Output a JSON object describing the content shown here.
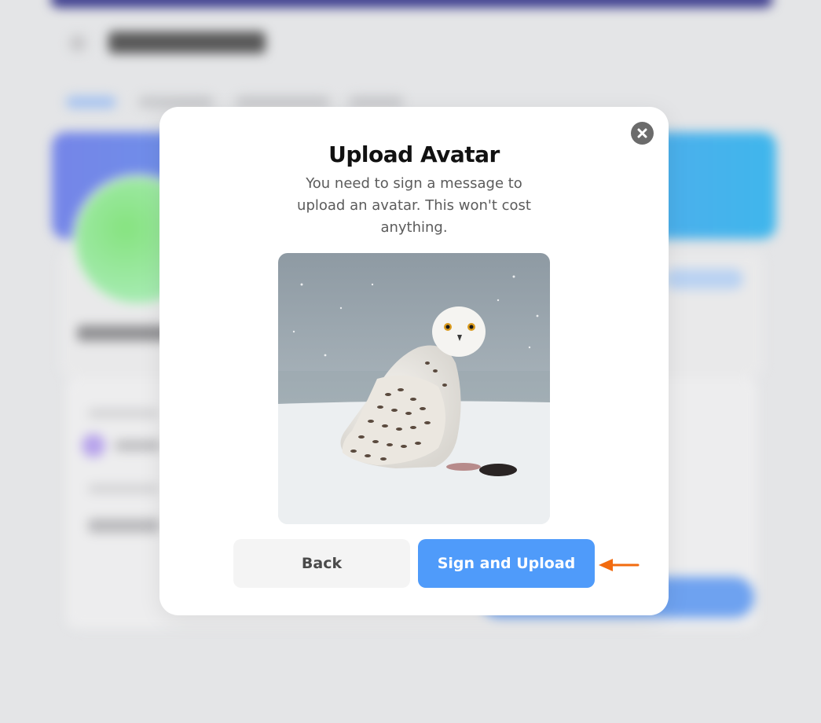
{
  "modal": {
    "title": "Upload Avatar",
    "description": "You need to sign a message to upload an avatar. This won't cost anything.",
    "close_icon": "close-icon",
    "back_label": "Back",
    "sign_label": "Sign and Upload",
    "image_subject": "snowy owl on snow"
  },
  "colors": {
    "primary_button": "#4f9bfa",
    "secondary_button": "#f4f4f4",
    "annotation_arrow": "#f26b0f"
  }
}
